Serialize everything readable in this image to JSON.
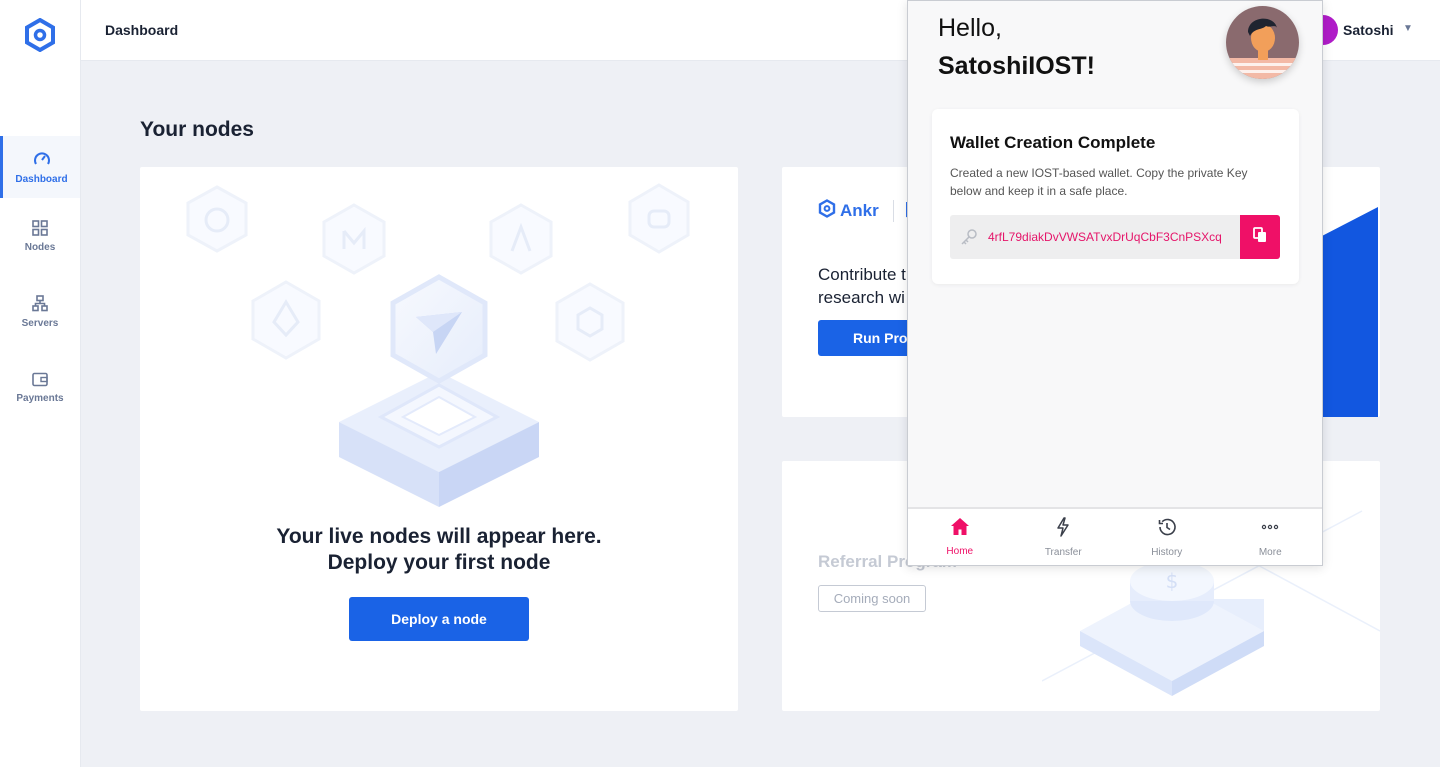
{
  "colors": {
    "accent": "#2f6fe8",
    "primary_button": "#1a63e6",
    "wallet_accent": "#ef1067"
  },
  "header": {
    "title": "Dashboard",
    "user_name": "Satoshi"
  },
  "sidebar": {
    "items": [
      {
        "label": "Dashboard",
        "icon": "gauge-icon",
        "active": true
      },
      {
        "label": "Nodes",
        "icon": "grid-icon",
        "active": false
      },
      {
        "label": "Servers",
        "icon": "network-icon",
        "active": false
      },
      {
        "label": "Payments",
        "icon": "wallet-icon",
        "active": false
      }
    ]
  },
  "main": {
    "section_title": "Your nodes",
    "nodes_card": {
      "message_line1": "Your live nodes will appear here.",
      "message_line2": "Deploy your first node",
      "button": "Deploy a node"
    },
    "project_card": {
      "logo_text": "Ankr",
      "text_line1": "Contribute t",
      "text_line2": "research wi",
      "button": "Run Proj"
    },
    "referral_card": {
      "title": "Referral Program",
      "badge": "Coming soon"
    }
  },
  "wallet_popup": {
    "greeting": "Hello,",
    "name": "SatoshiIOST!",
    "card_title": "Wallet Creation Complete",
    "card_desc": "Created a new IOST-based wallet. Copy the private Key below and keep it in a safe place.",
    "private_key": "4rfL79diakDvVWSATvxDrUqCbF3CnPSXcq",
    "tabs": [
      {
        "label": "Home",
        "icon": "home-icon",
        "active": true
      },
      {
        "label": "Transfer",
        "icon": "lightning-icon",
        "active": false
      },
      {
        "label": "History",
        "icon": "history-icon",
        "active": false
      },
      {
        "label": "More",
        "icon": "more-icon",
        "active": false
      }
    ]
  }
}
